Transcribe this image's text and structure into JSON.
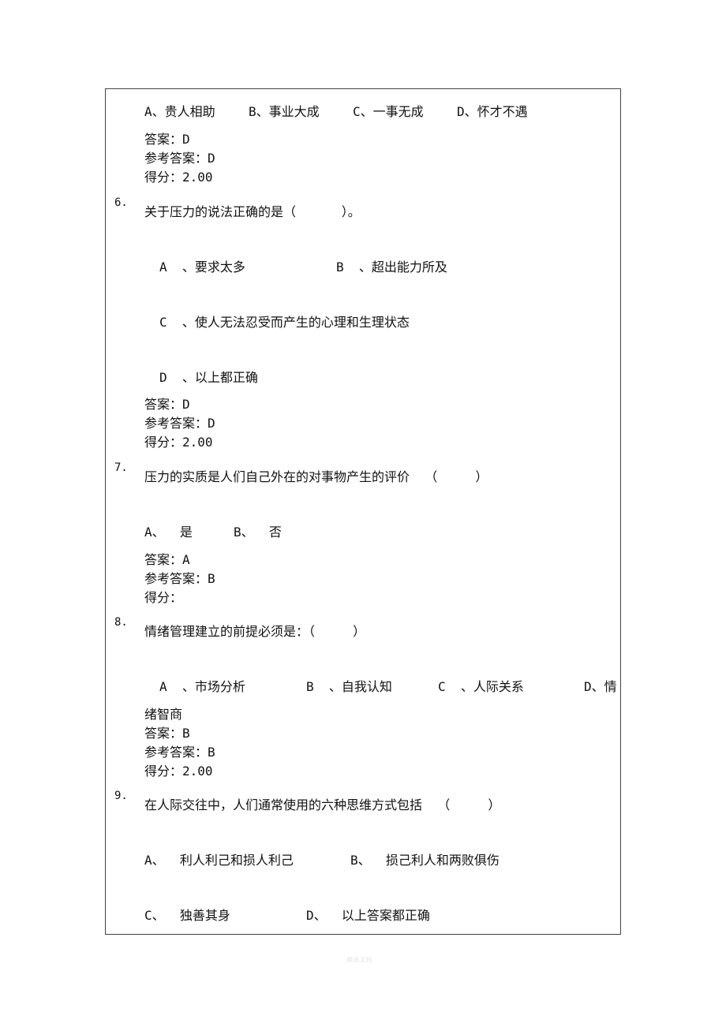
{
  "q5": {
    "options": [
      "A、贵人相助",
      "B、事业大成",
      "C、一事无成",
      "D、怀才不遇"
    ],
    "answer": "答案：D",
    "reference": "参考答案：D",
    "score": "得分：2.00"
  },
  "q6": {
    "number": "6.",
    "question": "关于压力的说法正确的是（      ）。",
    "options": [
      "A  、要求太多",
      "B  、超出能力所及",
      "C  、使人无法忍受而产生的心理和生理状态",
      "D  、以上都正确"
    ],
    "answer": "答案：D",
    "reference": "参考答案：D",
    "score": "得分：2.00"
  },
  "q7": {
    "number": "7.",
    "question": "压力的实质是人们自己外在的对事物产生的评价  （     ）",
    "options": [
      "A、  是",
      "B、  否"
    ],
    "answer": "答案：A",
    "reference": "参考答案：B",
    "score": "得分："
  },
  "q8": {
    "number": "8.",
    "question": "情绪管理建立的前提必须是：（     ）",
    "options": [
      "A  、市场分析",
      "B  、自我认知",
      "C  、人际关系",
      "D、情"
    ],
    "option_wrap": "绪智商",
    "answer": "答案：B",
    "reference": "参考答案：B",
    "score": "得分：2.00"
  },
  "q9": {
    "number": "9.",
    "question": "在人际交往中，人们通常使用的六种思维方式包括  （     ）",
    "options": [
      "A、  利人利己和损人利己",
      "B、  损己利人和两败俱伤",
      "C、  独善其身",
      "D、  以上答案都正确"
    ]
  },
  "watermark": "精品文档"
}
